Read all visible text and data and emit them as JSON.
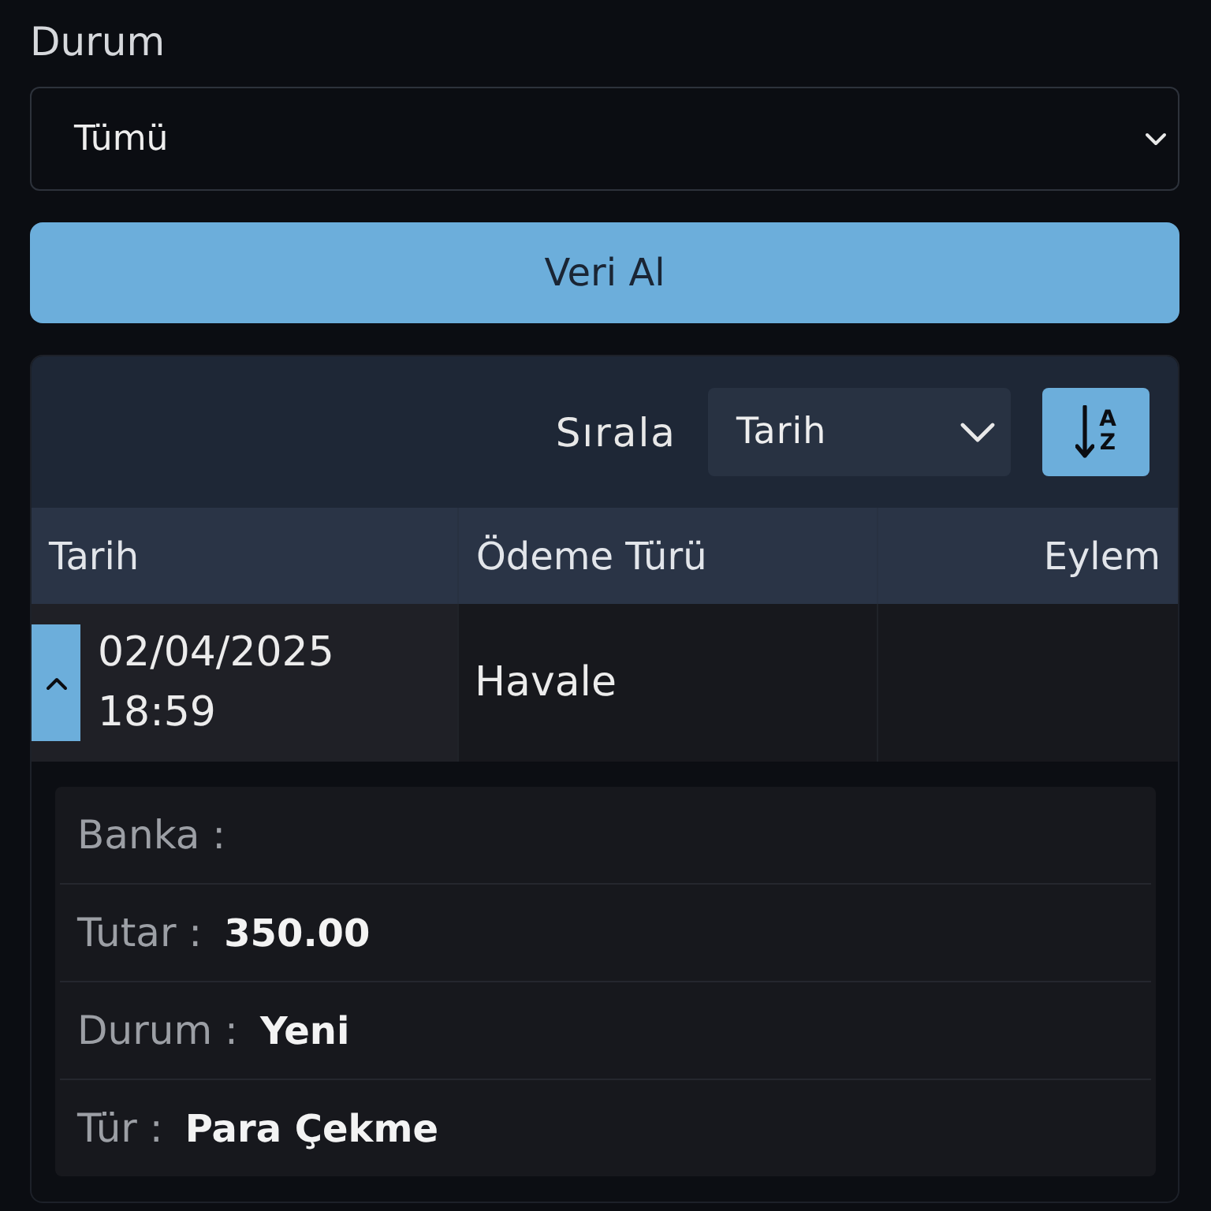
{
  "filter": {
    "label": "Durum",
    "select": {
      "value": "Tümü"
    }
  },
  "fetch_button": {
    "label": "Veri Al"
  },
  "results": {
    "sort": {
      "label": "Sırala",
      "select": {
        "value": "Tarih"
      },
      "button": {
        "letters": [
          "A",
          "Z"
        ]
      }
    },
    "table": {
      "columns": [
        "Tarih",
        "Ödeme Türü",
        "Eylem"
      ],
      "rows": [
        {
          "date": "02/04/2025",
          "time": "18:59",
          "payment_type": "Havale",
          "expanded": true,
          "details": [
            {
              "label": "Banka :"
            },
            {
              "label": "Tutar :",
              "value": "350.00"
            },
            {
              "label": "Durum :",
              "value": "Yeni"
            },
            {
              "label": "Tür :",
              "value": "Para Çekme"
            }
          ]
        }
      ]
    }
  }
}
